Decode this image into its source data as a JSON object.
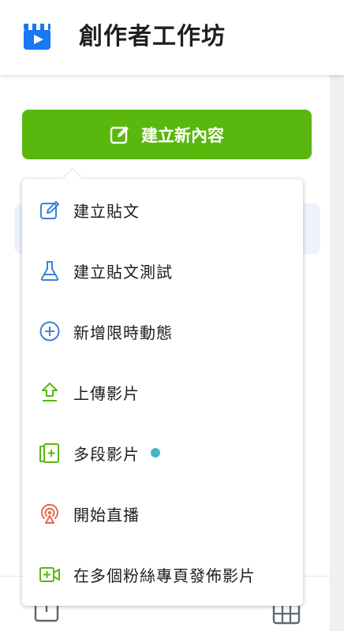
{
  "header": {
    "title": "創作者工作坊",
    "icon": "clapperboard-play-icon"
  },
  "create_button": {
    "label": "建立新內容",
    "icon": "compose-icon"
  },
  "menu": {
    "items": [
      {
        "label": "建立貼文",
        "icon": "edit-pencil-icon"
      },
      {
        "label": "建立貼文測試",
        "icon": "flask-icon"
      },
      {
        "label": "新增限時動態",
        "icon": "plus-circle-icon"
      },
      {
        "label": "上傳影片",
        "icon": "upload-arrow-icon"
      },
      {
        "label": "多段影片",
        "icon": "multi-clip-icon",
        "badge": "new-dot"
      },
      {
        "label": "開始直播",
        "icon": "live-broadcast-icon"
      },
      {
        "label": "在多個粉絲專頁發佈影片",
        "icon": "video-add-icon"
      }
    ]
  },
  "colors": {
    "accent_green": "#5ab70d",
    "icon_blue": "#3b82d6",
    "icon_green": "#5ab70d",
    "icon_red": "#e5684f",
    "dot_teal": "#4ab3c4"
  }
}
